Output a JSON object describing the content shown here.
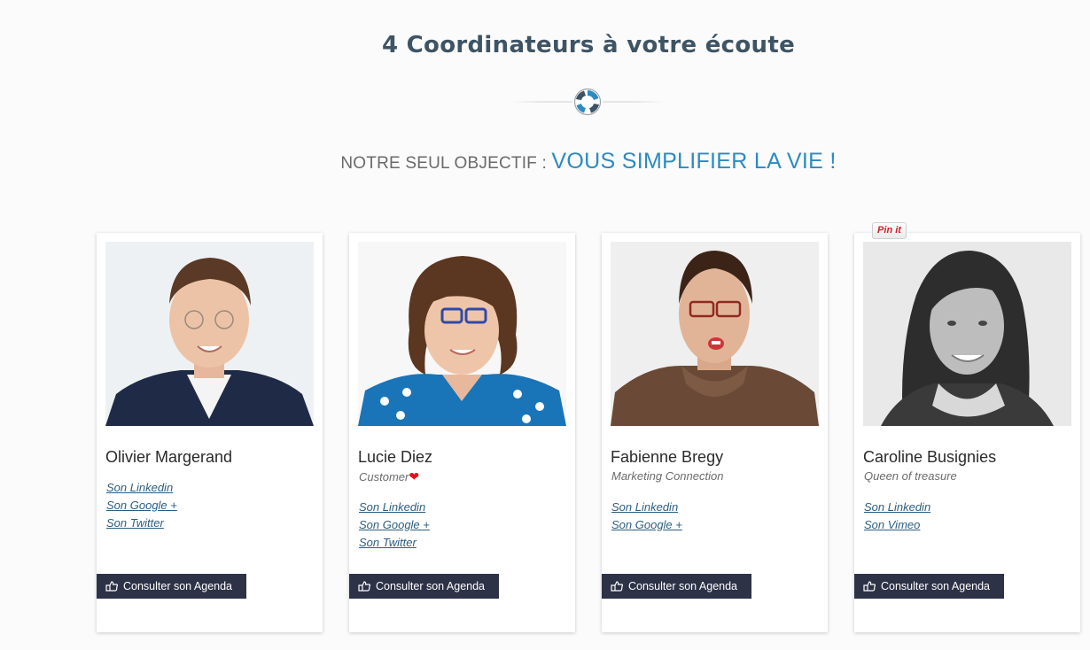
{
  "header": {
    "title": "4 Coordinateurs à votre écoute",
    "subtitle_muted": "NOTRE SEUL OBJECTIF : ",
    "subtitle_accent": "VOUS SIMPLIFIER LA VIE !"
  },
  "colors": {
    "title": "#3e5464",
    "accent": "#2c8bbf",
    "button": "#2d3247",
    "link": "#2d5d80",
    "heart": "#e3101d"
  },
  "pinterest": {
    "label": "Pin it"
  },
  "coordinators": [
    {
      "name": "Olivier Margerand",
      "role": "",
      "links": [
        "Son Linkedin",
        "Son Google +",
        "Son Twitter"
      ],
      "button_label": "Consulter son Agenda"
    },
    {
      "name": "Lucie Diez",
      "role": "Customer",
      "role_icon": "heart-icon",
      "links": [
        "Son Linkedin",
        "Son Google +",
        "Son Twitter"
      ],
      "button_label": "Consulter son Agenda"
    },
    {
      "name": "Fabienne Bregy",
      "role": "Marketing Connection",
      "links": [
        "Son Linkedin",
        "Son Google +"
      ],
      "button_label": "Consulter son Agenda"
    },
    {
      "name": "Caroline Busignies",
      "role": "Queen of treasure",
      "links": [
        "Son Linkedin",
        "Son Vimeo"
      ],
      "button_label": "Consulter son Agenda"
    }
  ]
}
